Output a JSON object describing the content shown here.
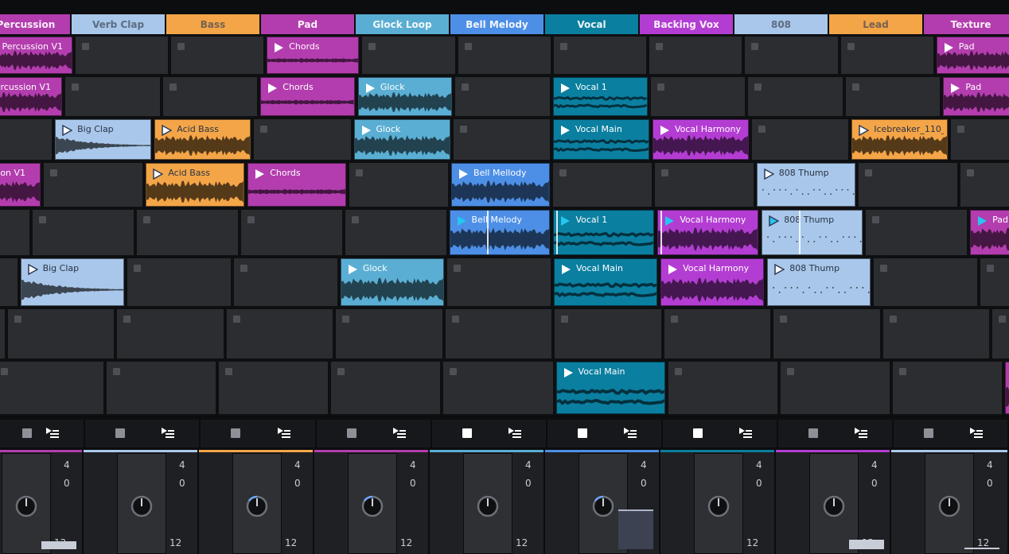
{
  "tracks": [
    {
      "name": "Percussion",
      "color": "#b33dae"
    },
    {
      "name": "Verb Clap",
      "color": "#a9c7ea"
    },
    {
      "name": "Bass",
      "color": "#f4a548"
    },
    {
      "name": "Pad",
      "color": "#b33dae"
    },
    {
      "name": "Glock Loop",
      "color": "#5aaed3"
    },
    {
      "name": "Bell Melody",
      "color": "#4d8fe6"
    },
    {
      "name": "Vocal",
      "color": "#0b7fa0"
    },
    {
      "name": "Backing Vox",
      "color": "#b33dd2"
    },
    {
      "name": "808",
      "color": "#a9c7ea"
    },
    {
      "name": "Lead",
      "color": "#f4a548"
    },
    {
      "name": "Texture",
      "color": "#b33dae"
    }
  ],
  "clips": [
    {
      "row": 0,
      "col": 0,
      "name": "Percussion V1",
      "color": "#b33dae",
      "wave": "dense"
    },
    {
      "row": 0,
      "col": 3,
      "name": "Chords",
      "color": "#b33dae",
      "wave": "flat"
    },
    {
      "row": 0,
      "col": 10,
      "name": "Pad",
      "color": "#b33dae",
      "wave": "dense"
    },
    {
      "row": 1,
      "col": 0,
      "name": "Percussion V1",
      "color": "#b33dae",
      "wave": "dense"
    },
    {
      "row": 1,
      "col": 3,
      "name": "Chords",
      "color": "#b33dae",
      "wave": "flat"
    },
    {
      "row": 1,
      "col": 4,
      "name": "Glock",
      "color": "#5aaed3",
      "wave": "dense"
    },
    {
      "row": 1,
      "col": 6,
      "name": "Vocal 1",
      "color": "#0b7fa0",
      "wave": "lines"
    },
    {
      "row": 1,
      "col": 10,
      "name": "Pad",
      "color": "#b33dae",
      "wave": "dense"
    },
    {
      "row": 2,
      "col": 1,
      "name": "Big Clap",
      "color": "#a9c7ea",
      "wave": "decay"
    },
    {
      "row": 2,
      "col": 2,
      "name": "Acid Bass",
      "color": "#f4a548",
      "wave": "dense"
    },
    {
      "row": 2,
      "col": 4,
      "name": "Glock",
      "color": "#5aaed3",
      "wave": "dense"
    },
    {
      "row": 2,
      "col": 6,
      "name": "Vocal Main",
      "color": "#0b7fa0",
      "wave": "lines"
    },
    {
      "row": 2,
      "col": 7,
      "name": "Vocal Harmony",
      "color": "#b33dd2",
      "wave": "dense"
    },
    {
      "row": 2,
      "col": 9,
      "name": "Icebreaker_110_D...",
      "color": "#f4a548",
      "wave": "dense"
    },
    {
      "row": 3,
      "col": 0,
      "name": "Percussion V1",
      "color": "#b33dae",
      "wave": "dense"
    },
    {
      "row": 3,
      "col": 2,
      "name": "Acid Bass",
      "color": "#f4a548",
      "wave": "dense"
    },
    {
      "row": 3,
      "col": 3,
      "name": "Chords",
      "color": "#b33dae",
      "wave": "flat"
    },
    {
      "row": 3,
      "col": 5,
      "name": "Bell Mellody",
      "color": "#4d8fe6",
      "wave": "dense"
    },
    {
      "row": 3,
      "col": 8,
      "name": "808 Thump",
      "color": "#a9c7ea",
      "wave": "dots"
    },
    {
      "row": 4,
      "col": 5,
      "name": "Bell Melody",
      "color": "#4d8fe6",
      "wave": "dense",
      "playing": true,
      "cursor": 0.37
    },
    {
      "row": 4,
      "col": 6,
      "name": "Vocal 1",
      "color": "#0b7fa0",
      "wave": "lines",
      "playing": true,
      "cursor": 0.02
    },
    {
      "row": 4,
      "col": 7,
      "name": "Vocal Harmony",
      "color": "#b33dd2",
      "wave": "dense",
      "playing": true,
      "cursor": 0.02
    },
    {
      "row": 4,
      "col": 8,
      "name": "808 Thump",
      "color": "#a9c7ea",
      "wave": "dots",
      "playing": true,
      "cursor": 0.37
    },
    {
      "row": 4,
      "col": 10,
      "name": "Pad",
      "color": "#b33dae",
      "wave": "dense",
      "playing": true,
      "cursor": 0.4
    },
    {
      "row": 5,
      "col": 1,
      "name": "Big Clap",
      "color": "#a9c7ea",
      "wave": "decay"
    },
    {
      "row": 5,
      "col": 4,
      "name": "Glock",
      "color": "#5aaed3",
      "wave": "dense"
    },
    {
      "row": 5,
      "col": 6,
      "name": "Vocal Main",
      "color": "#0b7fa0",
      "wave": "lines"
    },
    {
      "row": 5,
      "col": 7,
      "name": "Vocal Harmony",
      "color": "#b33dd2",
      "wave": "dense"
    },
    {
      "row": 5,
      "col": 8,
      "name": "808 Thump",
      "color": "#a9c7ea",
      "wave": "dots"
    },
    {
      "row": 7,
      "col": 6,
      "name": "Vocal Main",
      "color": "#0b7fa0",
      "wave": "lines"
    },
    {
      "row": 7,
      "col": 10,
      "name": "",
      "color": "#b33dae",
      "wave": "dense"
    }
  ],
  "controls": {
    "stop_lit": [
      false,
      false,
      false,
      false,
      true,
      true,
      true,
      false,
      false
    ],
    "mixer": [
      {
        "val_top": "4",
        "val_mid": "0",
        "val_bottom": "12",
        "level": 0.08,
        "knob_arc": false
      },
      {
        "val_top": "4",
        "val_mid": "0",
        "val_bottom": "12",
        "level": 0.0,
        "knob_arc": false
      },
      {
        "val_top": "4",
        "val_mid": "0",
        "val_bottom": "12",
        "level": 0.0,
        "knob_arc": true
      },
      {
        "val_top": "4",
        "val_mid": "0",
        "val_bottom": "12",
        "level": 0.0,
        "knob_arc": true
      },
      {
        "val_top": "4",
        "val_mid": "0",
        "val_bottom": "12",
        "level": 0.0,
        "knob_arc": false
      },
      {
        "val_top": "4",
        "val_mid": "0",
        "val_bottom": "12",
        "level": 0.4,
        "knob_arc": true
      },
      {
        "val_top": "4",
        "val_mid": "0",
        "val_bottom": "12",
        "level": 0.0,
        "knob_arc": false
      },
      {
        "val_top": "4",
        "val_mid": "0",
        "val_bottom": "12",
        "level": 0.1,
        "knob_arc": false
      },
      {
        "val_top": "4",
        "val_mid": "0",
        "val_bottom": "12",
        "level": 0.02,
        "knob_arc": false
      }
    ]
  }
}
